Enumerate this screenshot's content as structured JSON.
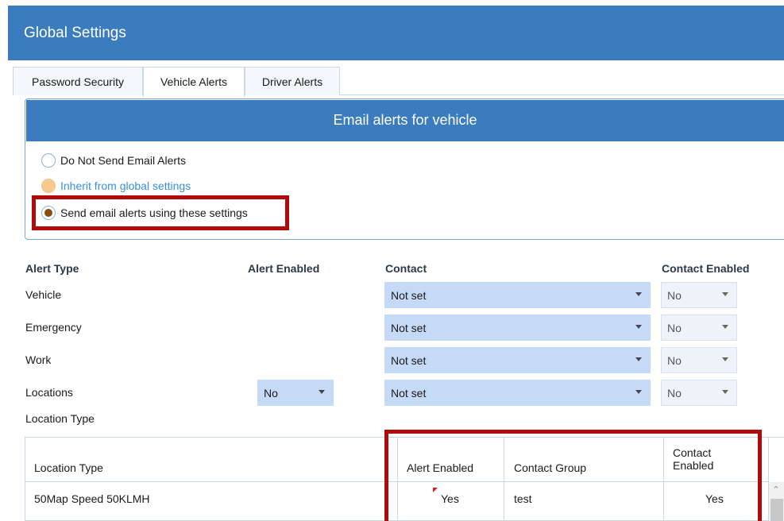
{
  "window": {
    "title": "Global Settings"
  },
  "tabs": [
    {
      "label": "Password Security"
    },
    {
      "label": "Vehicle Alerts"
    },
    {
      "label": "Driver Alerts"
    }
  ],
  "panel": {
    "title": "Email alerts for vehicle",
    "options": [
      {
        "label": "Do Not Send Email Alerts"
      },
      {
        "label": "Inherit from global settings"
      },
      {
        "label": "Send email alerts using these settings"
      }
    ]
  },
  "alerts": {
    "headers": {
      "alert_type": "Alert Type",
      "alert_enabled": "Alert Enabled",
      "contact": "Contact",
      "contact_enabled": "Contact Enabled"
    },
    "rows": [
      {
        "type": "Vehicle",
        "contact": "Not set",
        "contact_enabled": "No"
      },
      {
        "type": "Emergency",
        "contact": "Not set",
        "contact_enabled": "No"
      },
      {
        "type": "Work",
        "contact": "Not set",
        "contact_enabled": "No"
      },
      {
        "type": "Locations",
        "alert_enabled": "No",
        "contact": "Not set",
        "contact_enabled": "No"
      }
    ],
    "location_type_label": "Location Type"
  },
  "location_grid": {
    "headers": {
      "location_type": "Location Type",
      "alert_enabled": "Alert Enabled",
      "contact_group": "Contact Group",
      "contact_enabled": "Contact Enabled"
    },
    "rows": [
      {
        "location_type": "50Map Speed 50KLMH",
        "alert_enabled": "Yes",
        "contact_group": "test",
        "contact_enabled": "Yes"
      }
    ]
  },
  "icons": {
    "dropdown": "chevron-down-icon",
    "scroll_up": "arrow-up-icon"
  },
  "colors": {
    "header_blue": "#3a7cbd",
    "highlight_red": "#b10a0a",
    "select_blue": "#c5daf7",
    "radio_checked": "#8a4b0e",
    "radio_disabled": "#f7c98d"
  }
}
